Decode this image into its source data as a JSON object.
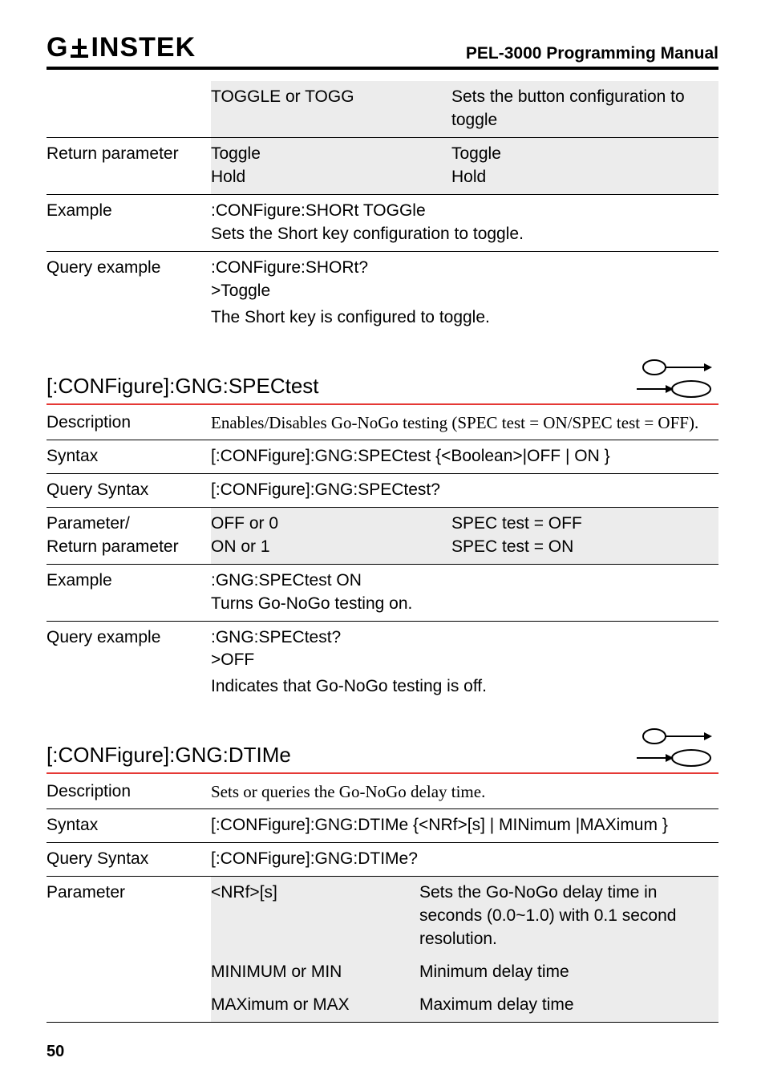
{
  "header": {
    "logo_left": "G",
    "logo_right": "INSTEK",
    "doc_title": "PEL-3000 Programming Manual"
  },
  "block1": {
    "r0_val": "TOGGLE or TOGG",
    "r0_desc": "Sets the button configuration to toggle",
    "r1_label": "Return parameter",
    "r1_val1": "Toggle",
    "r1_val2": "Hold",
    "r1_desc1": "Toggle",
    "r1_desc2": "Hold",
    "r2_label": "Example",
    "r2_line1": ":CONFigure:SHORt TOGGle",
    "r2_line2": "Sets the Short key configuration to toggle.",
    "r3_label": "Query example",
    "r3_line1": ":CONFigure:SHORt?",
    "r3_line2": ">Toggle",
    "r3_line3": "The Short key is configured to toggle."
  },
  "section1_title": "[:CONFigure]:GNG:SPECtest",
  "block2": {
    "r0_label": "Description",
    "r0_text": "Enables/Disables Go-NoGo testing (SPEC test = ON/SPEC test = OFF).",
    "r1_label": "Syntax",
    "r1_text": "[:CONFigure]:GNG:SPECtest {<Boolean>|OFF | ON }",
    "r2_label": "Query Syntax",
    "r2_text": "[:CONFigure]:GNG:SPECtest?",
    "r3_label1": "Parameter/",
    "r3_label2": "Return parameter",
    "r3_val1": "OFF or 0",
    "r3_val2": "ON or 1",
    "r3_desc1": "SPEC test = OFF",
    "r3_desc2": "SPEC test = ON",
    "r4_label": "Example",
    "r4_line1": ":GNG:SPECtest ON",
    "r4_line2": "Turns Go-NoGo testing on.",
    "r5_label": "Query example",
    "r5_line1": ":GNG:SPECtest?",
    "r5_line2": ">OFF",
    "r5_line3": "Indicates that Go-NoGo testing is off."
  },
  "section2_title": "[:CONFigure]:GNG:DTIMe",
  "block3": {
    "r0_label": "Description",
    "r0_text": "Sets or queries the Go-NoGo delay time.",
    "r1_label": "Syntax",
    "r1_text": "[:CONFigure]:GNG:DTIMe {<NRf>[s] | MINimum |MAXimum }",
    "r2_label": "Query Syntax",
    "r2_text": "[:CONFigure]:GNG:DTIMe?",
    "r3_label": "Parameter",
    "r3_val1": "<NRf>[s]",
    "r3_desc1": "Sets the Go-NoGo delay time in seconds (0.0~1.0) with 0.1 second resolution.",
    "r3_val2": "MINIMUM or MIN",
    "r3_desc2": "Minimum delay time",
    "r3_val3": "MAXimum or MAX",
    "r3_desc3": "Maximum delay time"
  },
  "page_number": "50"
}
